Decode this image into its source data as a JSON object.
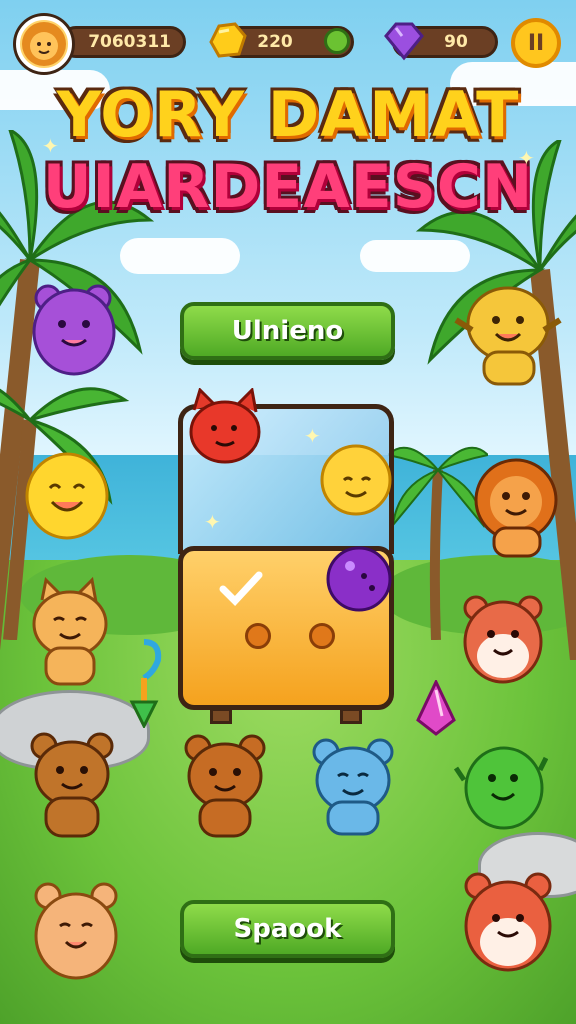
{
  "hud": {
    "coins": "7060311",
    "gold": "220",
    "gems": "90",
    "pause_label": "II"
  },
  "title": {
    "line1": "YORY DAMAT",
    "line2": "UIARDEAESCN"
  },
  "buttons": {
    "top_label": "Ulnieno",
    "bottom_label": "Spaook"
  },
  "icons": {
    "avatar": "lion-face-icon",
    "gold": "gold-nugget-icon",
    "gem": "purple-gem-icon",
    "pause": "pause-icon"
  },
  "colors": {
    "button_green": "#5cb82c",
    "title_yellow": "#ffd21c",
    "title_pink": "#ff3f7a",
    "hud_brown": "#6b3f24"
  }
}
